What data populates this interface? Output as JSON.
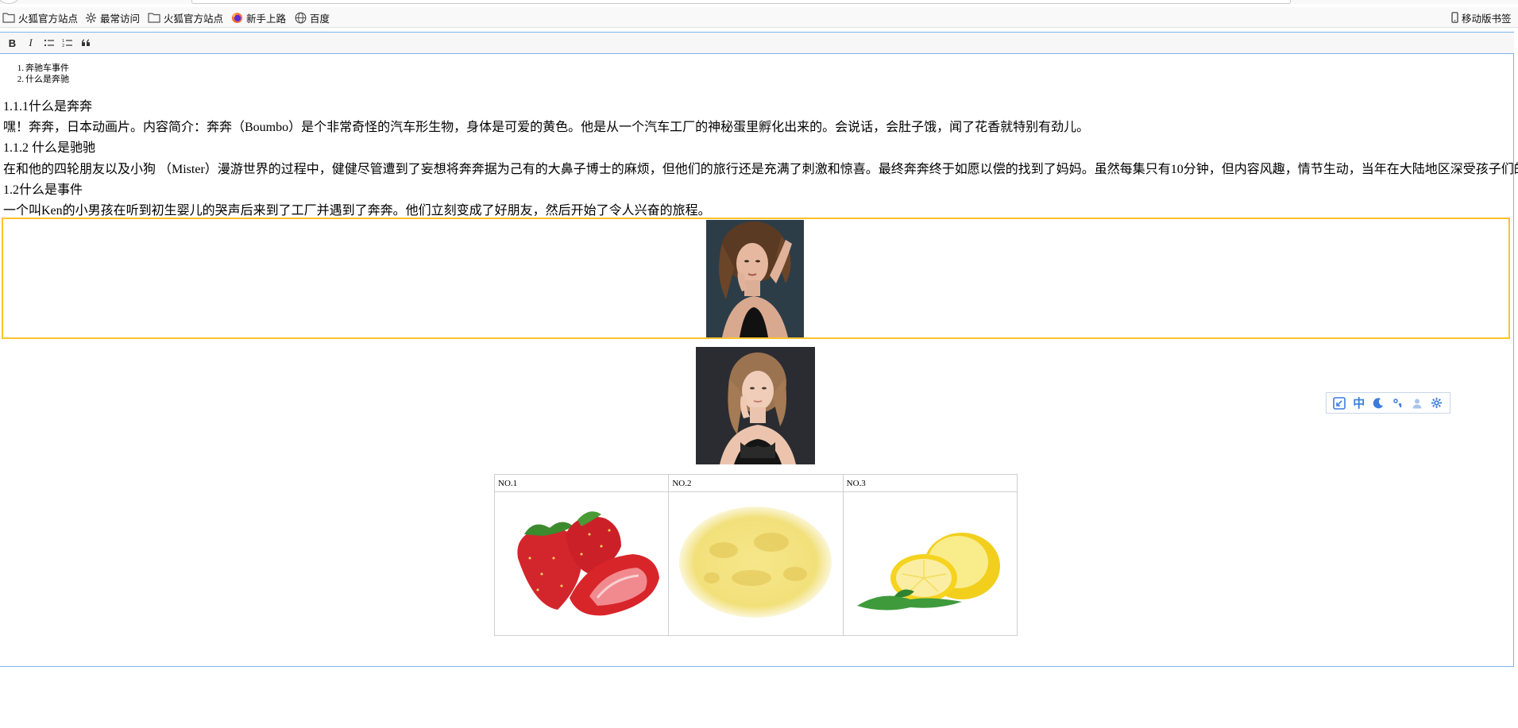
{
  "bookmarks": {
    "items": [
      {
        "label": "火狐官方站点",
        "icon": "folder-icon"
      },
      {
        "label": "最常访问",
        "icon": "gear-icon"
      },
      {
        "label": "火狐官方站点",
        "icon": "folder-icon"
      },
      {
        "label": "新手上路",
        "icon": "firefox-icon"
      },
      {
        "label": "百度",
        "icon": "globe-icon"
      }
    ],
    "mobile": {
      "label": "移动版书签",
      "icon": "mobile-icon"
    }
  },
  "toolbar": {
    "bold_label": "B",
    "italic_label": "I",
    "bullet_list_icon": "bullet-list-icon",
    "numbered_list_icon": "numbered-list-icon",
    "quote_icon": "quote-icon"
  },
  "content": {
    "list": [
      {
        "num": "1.",
        "text": "奔驰车事件"
      },
      {
        "num": "2.",
        "text": "什么是奔驰"
      }
    ],
    "h1": "1.1.1什么是奔奔",
    "p1": "嘿！奔奔，日本动画片。内容简介：奔奔（Boumbo）是个非常奇怪的汽车形生物，身体是可爱的黄色。他是从一个汽车工厂的神秘蛋里孵化出来的。会说话，会肚子饿，闻了花香就特别有劲儿。",
    "h2": "1.1.2 什么是驰驰",
    "p2": "在和他的四轮朋友以及小狗 （Mister）漫游世界的过程中，健健尽管遭到了妄想将奔奔据为己有的大鼻子博士的麻烦，但他们的旅行还是充满了刺激和惊喜。最终奔奔终于如愿以偿的找到了妈妈。虽然每集只有10分钟，但内容风趣，情节生动，当年在大陆地区深受孩子们的喜爱。",
    "h3": "1.2什么是事件",
    "p3": "一个叫Ken的小男孩在听到初生婴儿的哭声后来到了工厂并遇到了奔奔。他们立刻变成了好朋友，然后开始了令人兴奋的旅程。"
  },
  "table": {
    "headers": [
      "NO.1",
      "NO.2",
      "NO.3"
    ],
    "cells": [
      "strawberry-image",
      "moon-image",
      "lemon-image"
    ]
  },
  "float_toolbar": {
    "items": [
      "resize-icon",
      "chinese-char-icon",
      "moon-icon",
      "punctuation-icon",
      "user-icon",
      "settings-icon"
    ],
    "chinese_char": "中"
  },
  "colors": {
    "accent": "#3b7ddd",
    "editor_border": "#7eb4ea",
    "selected_border": "#fbc22b"
  }
}
